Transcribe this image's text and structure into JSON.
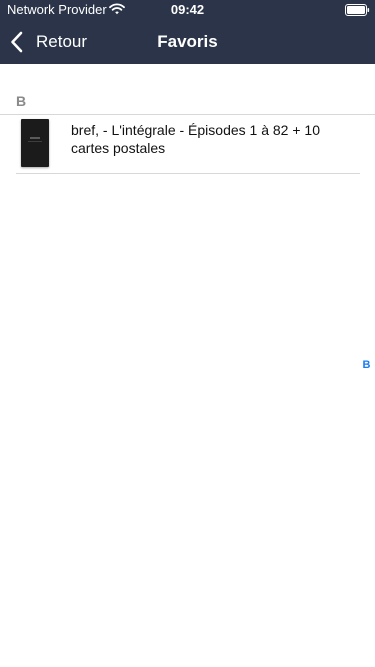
{
  "status_bar": {
    "carrier": "Network Provider",
    "time": "09:42"
  },
  "nav": {
    "back_label": "Retour",
    "title": "Favoris"
  },
  "favorites": {
    "sections": [
      {
        "header": "B",
        "items": [
          {
            "title": "bref, - L'intégrale - Épisodes 1 à 82 + 10 cartes postales"
          }
        ]
      }
    ]
  },
  "index": [
    "B"
  ],
  "colors": {
    "header_bg": "#2b3448",
    "index_accent": "#1a7cf0"
  },
  "icons": {
    "wifi": "wifi-icon",
    "battery": "battery-icon",
    "back": "chevron-left-icon"
  }
}
